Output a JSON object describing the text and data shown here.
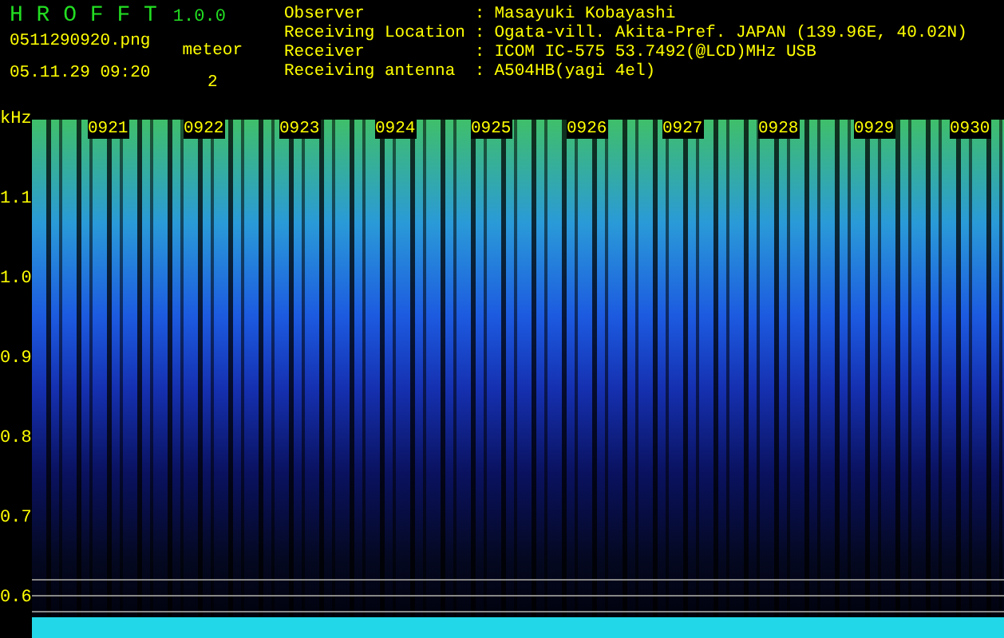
{
  "app": {
    "name": "H R O F F T",
    "version": "1.0.0"
  },
  "file": {
    "filename": "0511290920.png",
    "datetime": "05.11.29 09:20"
  },
  "meteor": {
    "label": "meteor",
    "count": "2"
  },
  "info": [
    {
      "label": "Observer",
      "separator": ":",
      "value": "Masayuki Kobayashi"
    },
    {
      "label": "Receiving Location",
      "separator": ":",
      "value": "Ogata-vill. Akita-Pref. JAPAN (139.96E, 40.02N)"
    },
    {
      "label": "Receiver",
      "separator": ":",
      "value": "ICOM IC-575 53.7492(@LCD)MHz USB"
    },
    {
      "label": "Receiving antenna",
      "separator": ":",
      "value": "A504HB(yagi 4el)"
    }
  ],
  "spectrogram": {
    "unit": "kHz",
    "time_labels": [
      "0921",
      "0922",
      "0923",
      "0924",
      "0925",
      "0926",
      "0927",
      "0928",
      "0929",
      "0930"
    ],
    "frequency_labels": [
      "1.1",
      "1.0",
      "0.9",
      "0.8",
      "0.7",
      "0.6"
    ]
  }
}
